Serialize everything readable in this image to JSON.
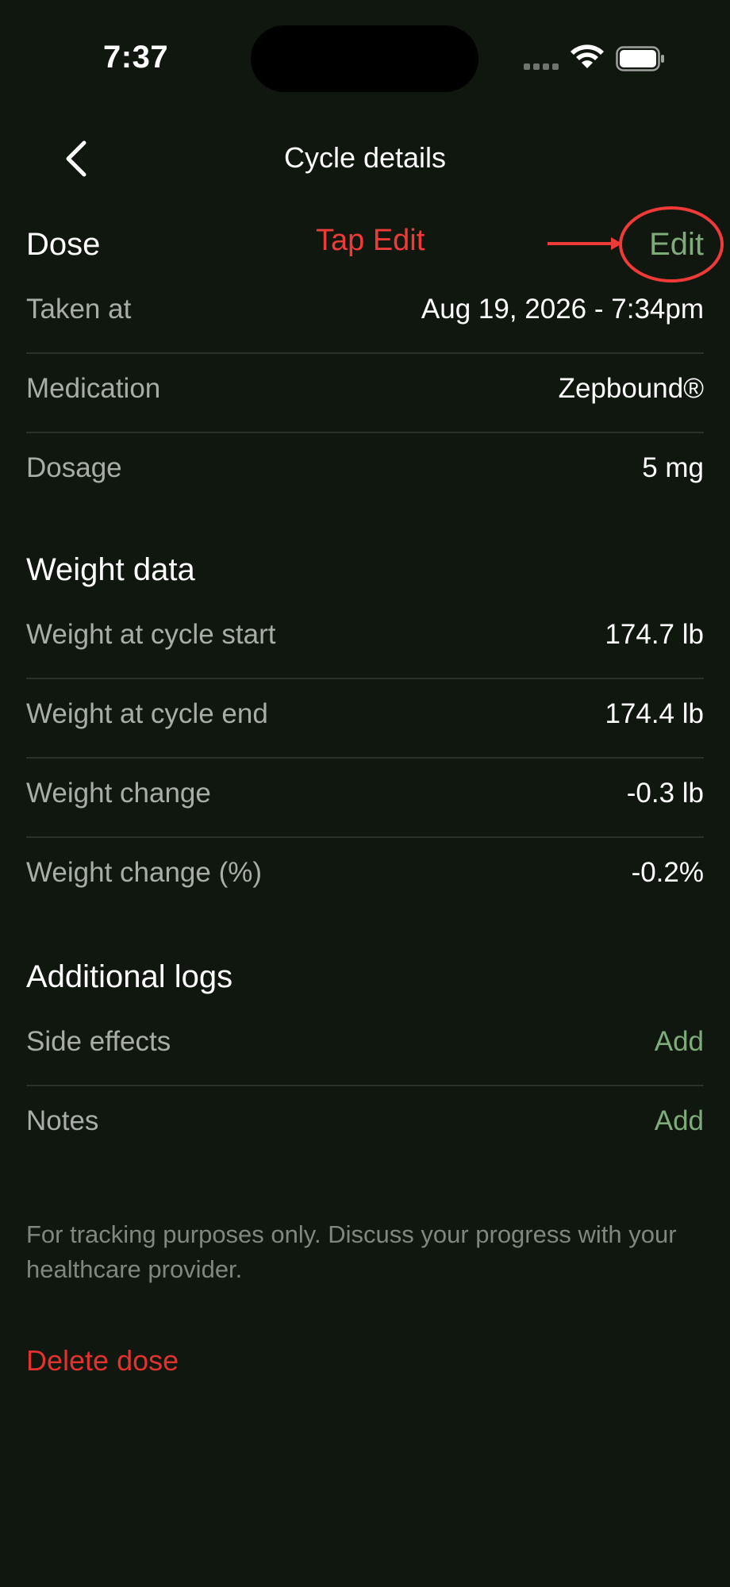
{
  "status_bar": {
    "time": "7:37"
  },
  "nav": {
    "title": "Cycle details"
  },
  "dose": {
    "title": "Dose",
    "edit_label": "Edit",
    "rows": [
      {
        "label": "Taken at",
        "value": "Aug 19, 2026 - 7:34pm"
      },
      {
        "label": "Medication",
        "value": "Zepbound®"
      },
      {
        "label": "Dosage",
        "value": "5 mg"
      }
    ]
  },
  "annotation": {
    "hint": "Tap Edit",
    "color": "#ee3b38"
  },
  "weight": {
    "title": "Weight data",
    "rows": [
      {
        "label": "Weight at cycle start",
        "value": "174.7 lb"
      },
      {
        "label": "Weight at cycle end",
        "value": "174.4 lb"
      },
      {
        "label": "Weight change",
        "value": "-0.3 lb"
      },
      {
        "label": "Weight change (%)",
        "value": "-0.2%"
      }
    ]
  },
  "additional": {
    "title": "Additional logs",
    "rows": [
      {
        "label": "Side effects",
        "action": "Add"
      },
      {
        "label": "Notes",
        "action": "Add"
      }
    ]
  },
  "footnote": "For tracking purposes only. Discuss your progress with your healthcare provider.",
  "delete_label": "Delete dose",
  "colors": {
    "background": "#10170f",
    "accent": "#7fab7b",
    "destructive": "#e0332f"
  }
}
